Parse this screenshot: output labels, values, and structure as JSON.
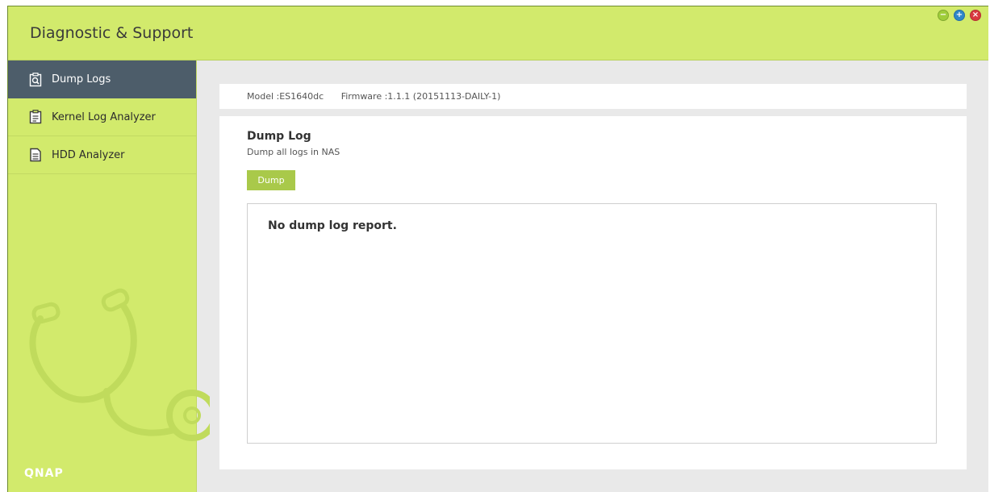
{
  "window": {
    "title": "Diagnostic & Support",
    "controls": [
      "minimize-icon",
      "maximize-icon",
      "close-icon"
    ]
  },
  "sidebar": {
    "items": [
      {
        "label": "Dump Logs",
        "icon": "dump-logs-icon",
        "active": true
      },
      {
        "label": "Kernel Log Analyzer",
        "icon": "clipboard-icon",
        "active": false
      },
      {
        "label": "HDD Analyzer",
        "icon": "document-icon",
        "active": false
      }
    ],
    "brand": "QNAP"
  },
  "info": {
    "model": "Model :ES1640dc",
    "firmware": "Firmware :1.1.1 (20151113-DAILY-1)"
  },
  "dump": {
    "title": "Dump Log",
    "subtitle": "Dump all logs in NAS",
    "button_label": "Dump",
    "report_text": "No dump log report."
  },
  "colors": {
    "accent": "#d2ea6c",
    "active_nav": "#4d5d6a",
    "button": "#a9c94a"
  }
}
